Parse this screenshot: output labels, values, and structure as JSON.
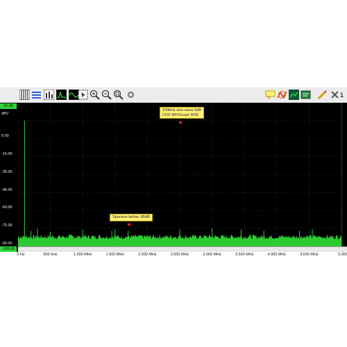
{
  "toolbar": {
    "left_icons": [
      "grid-icon",
      "channels-icon",
      "bars-icon",
      "spectrum-icon",
      "waveform-icon",
      "cursor-box-icon",
      "zoom-in-icon",
      "zoom-out-icon",
      "zoom-reset-icon",
      "settings-gear-icon"
    ],
    "right_icons": [
      "annotation-icon",
      "fit-icon",
      "display-icon",
      "measure-icon",
      "pen-icon",
      "close-icon"
    ],
    "page_number": "1"
  },
  "y_axis": {
    "unit": "dBV",
    "top_value": "15.00",
    "bottom_value": "-105.00",
    "ticks": [
      "0.00",
      "-15.00",
      "-30.00",
      "-45.00",
      "-60.00",
      "-75.00",
      "-90.00"
    ],
    "accent_color": "#2fd83a"
  },
  "x_axis": {
    "ticks": [
      "0 Hz",
      "500 kHz",
      "1.000 MHz",
      "1.500 MHz",
      "2.000 MHz",
      "2.500 MHz",
      "3.000 MHz",
      "3.500 MHz",
      "4.000 MHz",
      "4.500 MHz",
      "5.000"
    ]
  },
  "annotations": [
    {
      "lines": [
        "100kHz sine wave 0dB",
        "CDS WFIScope WS5"
      ]
    },
    {
      "lines": [
        "Spurious below -85dB"
      ]
    }
  ],
  "chart_data": {
    "type": "line",
    "xlabel": "",
    "ylabel": "dBV",
    "xlim": [
      0,
      5000000
    ],
    "ylim": [
      -105,
      15
    ],
    "grid": true,
    "series_color": "#35ef3c",
    "noise_floor_db": -98,
    "peaks": [
      {
        "x": 100000,
        "y": 0
      },
      {
        "x": 200000,
        "y": -92
      },
      {
        "x": 300000,
        "y": -90
      },
      {
        "x": 500000,
        "y": -93
      },
      {
        "x": 1000000,
        "y": -91
      },
      {
        "x": 1450000,
        "y": -92
      },
      {
        "x": 1500000,
        "y": -91
      },
      {
        "x": 1700000,
        "y": -92
      },
      {
        "x": 2500000,
        "y": -91
      },
      {
        "x": 3000000,
        "y": -90
      },
      {
        "x": 3450000,
        "y": -91
      },
      {
        "x": 3800000,
        "y": -92
      },
      {
        "x": 4350000,
        "y": -92
      },
      {
        "x": 4550000,
        "y": -91
      }
    ]
  }
}
